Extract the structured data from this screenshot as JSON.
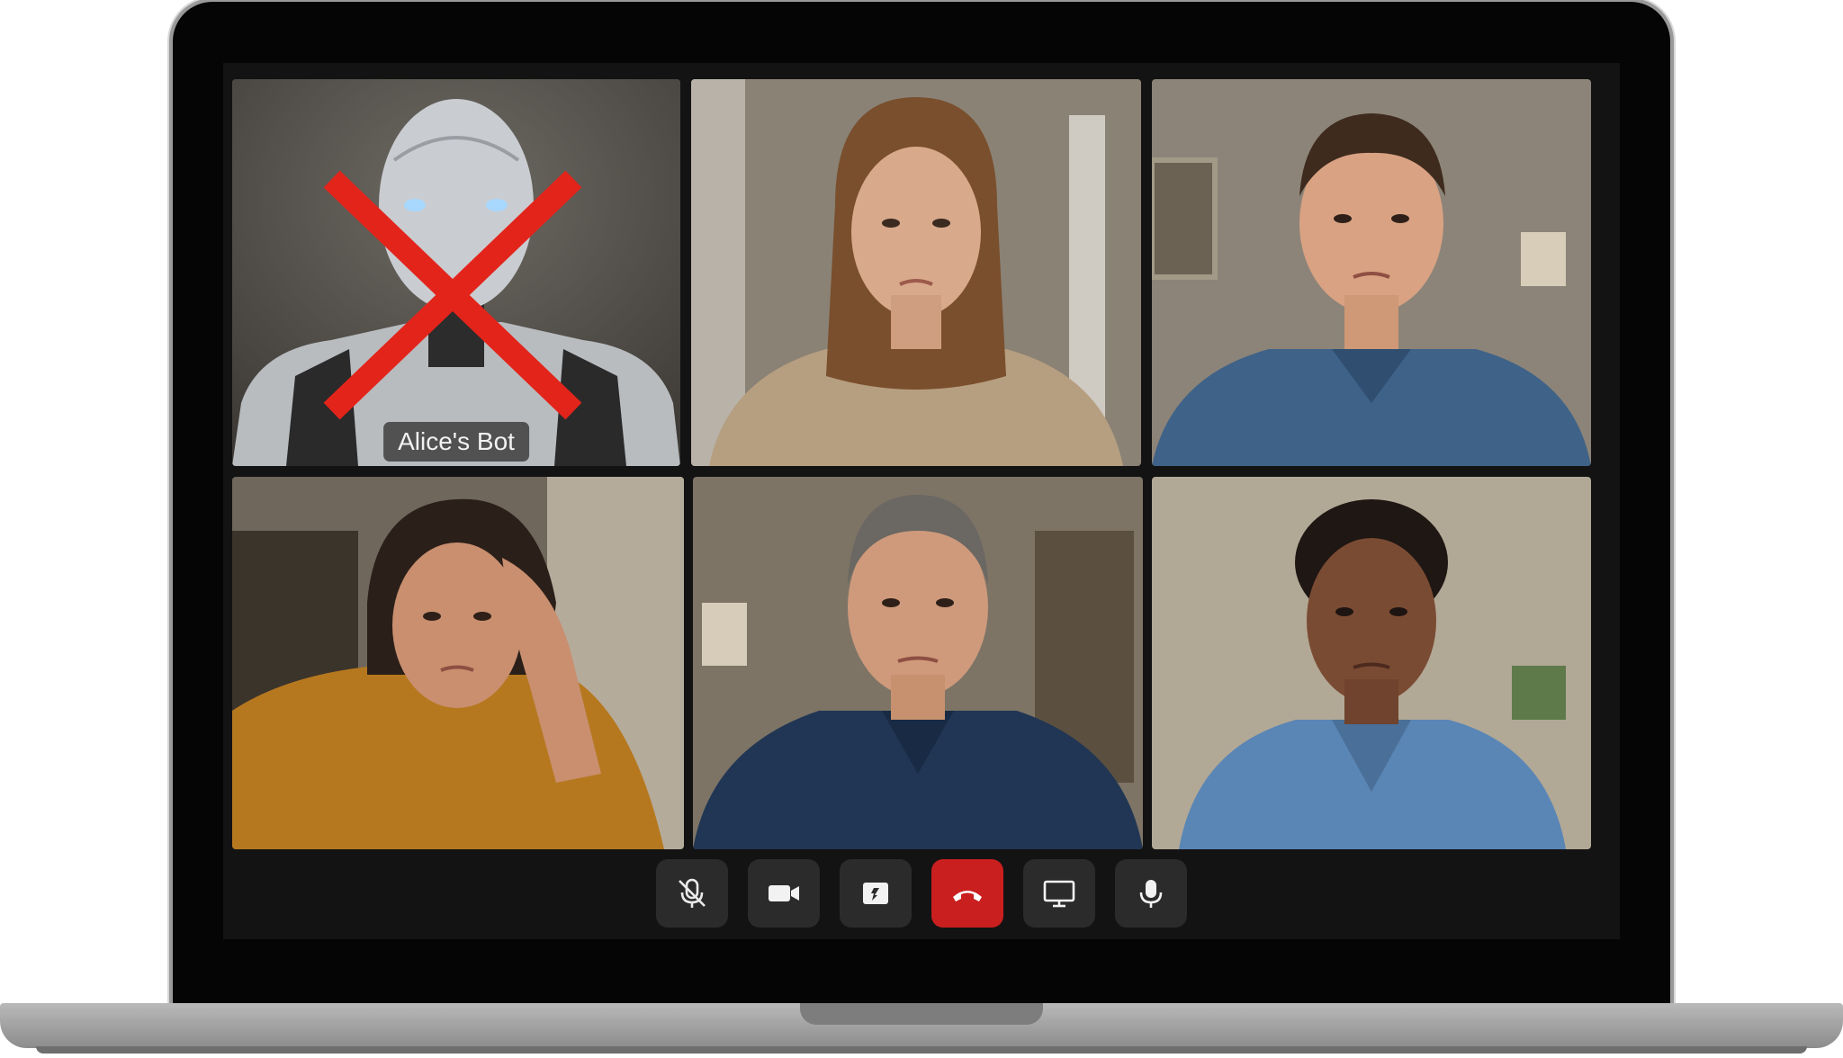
{
  "participants": [
    {
      "name": "Alice's Bot",
      "kind": "robot",
      "blocked": true
    },
    {
      "name": "",
      "kind": "person"
    },
    {
      "name": "",
      "kind": "person"
    },
    {
      "name": "",
      "kind": "person"
    },
    {
      "name": "",
      "kind": "person"
    },
    {
      "name": "",
      "kind": "person"
    }
  ],
  "controls": [
    {
      "icon": "mic-muted-icon"
    },
    {
      "icon": "camera-icon"
    },
    {
      "icon": "reactions-icon"
    },
    {
      "icon": "hang-up-icon"
    },
    {
      "icon": "screen-share-icon"
    },
    {
      "icon": "microphone-icon"
    }
  ],
  "colors": {
    "block_mark": "#e3241b",
    "hangup": "#c91f1f",
    "control_bg": "#2b2b2b"
  }
}
